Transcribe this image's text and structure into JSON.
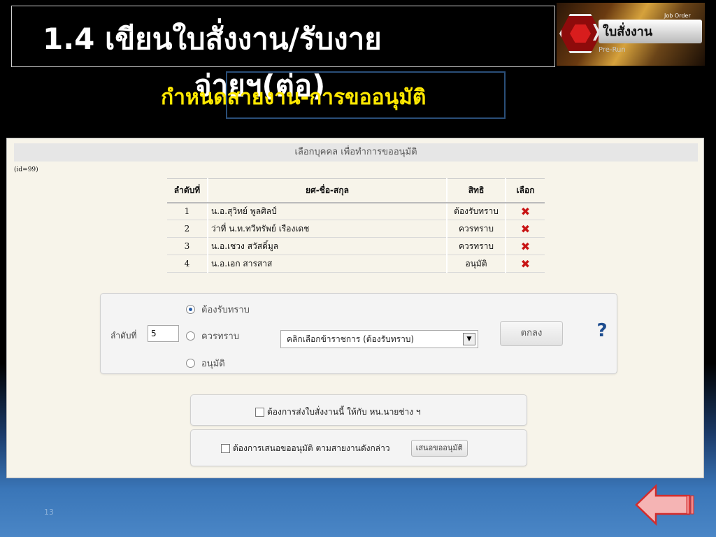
{
  "slide": {
    "title_line1": "1.4 เขียนใบสั่งงาน/รับงาย",
    "title_line2": "จ่ายฯ(ต่อ)",
    "subtitle": "กำหนดสายงาน-การขออนุมัติ",
    "page_number": "13"
  },
  "logo": {
    "text": "ใบสั่งงาน",
    "small_text": "Job Order",
    "sub_text": "Pre-Run"
  },
  "panel": {
    "header": "เลือกบุคคล เพื่อทำการขออนุมัติ",
    "id_label": "(id=99)",
    "columns": [
      "ลำดับที่",
      "ยศ-ชื่อ-สกุล",
      "สิทธิ",
      "เลือก"
    ],
    "rows": [
      {
        "no": "1",
        "name": "น.อ.สุวิทย์  พูลศิลป์",
        "role": "ต้องรับทราบ"
      },
      {
        "no": "2",
        "name": "ว่าที่ น.ท.ทวีทรัพย์  เรืองเดช",
        "role": "ควรทราบ"
      },
      {
        "no": "3",
        "name": "น.อ.เชวง  สวัสดิ์มูล",
        "role": "ควรทราบ"
      },
      {
        "no": "4",
        "name": "น.อ.เอก  สารสาส",
        "role": "อนุมัติ"
      }
    ],
    "remove_symbol": "✖"
  },
  "form": {
    "radio_options": [
      "ต้องรับทราบ",
      "ควรทราบ",
      "อนุมัติ"
    ],
    "selected_index": 0,
    "order_label": "ลำดับที่",
    "order_value": "5",
    "select_value": "คลิกเลือกข้าราชการ (ต้องรับทราบ)",
    "ok_button": "ตกลง",
    "help_symbol": "?"
  },
  "options": {
    "send_label": "ต้องการส่งใบสั่งงานนี้ ให้กับ หน.นายช่าง ฯ",
    "propose_label": "ต้องการเสนอขออนุมัติ ตามสายงานดังกล่าว",
    "propose_button": "เสนอขออนุมัติ"
  },
  "colors": {
    "subtitle": "#ffe800",
    "remove_icon": "#c81414",
    "help_icon": "#1e4d8f"
  }
}
